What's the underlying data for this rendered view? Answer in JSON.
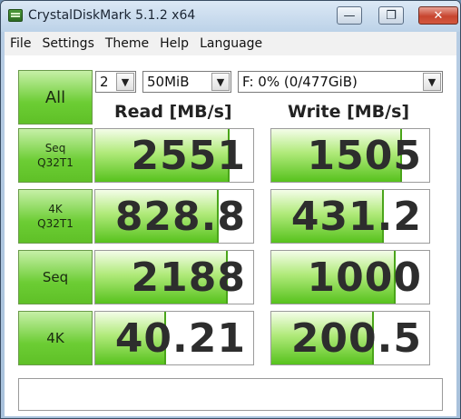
{
  "window": {
    "title": "CrystalDiskMark 5.1.2 x64",
    "buttons": {
      "minimize": "—",
      "maximize": "❐",
      "close": "✕"
    }
  },
  "menu": [
    "File",
    "Settings",
    "Theme",
    "Help",
    "Language"
  ],
  "controls": {
    "all_label": "All",
    "count_value": "2",
    "size_value": "50MiB",
    "drive_value": "F: 0% (0/477GiB)"
  },
  "headers": {
    "read": "Read [MB/s]",
    "write": "Write [MB/s]"
  },
  "rows": [
    {
      "label1": "Seq",
      "label2": "Q32T1",
      "read": "2551",
      "write": "1505",
      "read_fill": 0.85,
      "write_fill": 0.83
    },
    {
      "label1": "4K",
      "label2": "Q32T1",
      "read": "828.8",
      "write": "431.2",
      "read_fill": 0.78,
      "write_fill": 0.71
    },
    {
      "label1": "Seq",
      "label2": "",
      "read": "2188",
      "write": "1000",
      "read_fill": 0.84,
      "write_fill": 0.79
    },
    {
      "label1": "4K",
      "label2": "",
      "read": "40.21",
      "write": "200.5",
      "read_fill": 0.45,
      "write_fill": 0.65
    }
  ],
  "colors": {
    "accent_green": "#6ccd34",
    "bar_green": "#57c21d"
  }
}
